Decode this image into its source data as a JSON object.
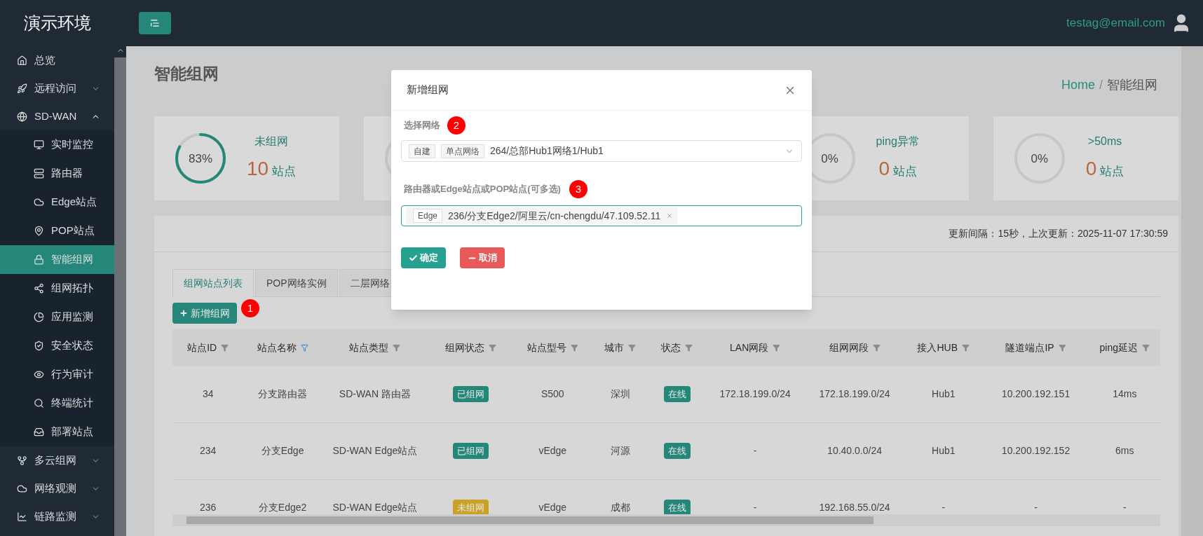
{
  "header": {
    "logo": "演示环境",
    "user": "testag@email.com"
  },
  "sidebar": {
    "items": [
      {
        "label": "总览",
        "expandable": false,
        "selected": false
      },
      {
        "label": "远程访问",
        "expandable": true,
        "expanded": false,
        "selected": false
      },
      {
        "label": "SD-WAN",
        "expandable": true,
        "expanded": true,
        "selected": false,
        "children": [
          {
            "label": "实时监控",
            "selected": false
          },
          {
            "label": "路由器",
            "selected": false
          },
          {
            "label": "Edge站点",
            "selected": false
          },
          {
            "label": "POP站点",
            "selected": false
          },
          {
            "label": "智能组网",
            "selected": true
          },
          {
            "label": "组网拓扑",
            "selected": false
          },
          {
            "label": "应用监测",
            "selected": false
          },
          {
            "label": "安全状态",
            "selected": false
          },
          {
            "label": "行为审计",
            "selected": false
          },
          {
            "label": "终端统计",
            "selected": false
          },
          {
            "label": "部署站点",
            "selected": false
          }
        ]
      },
      {
        "label": "多云组网",
        "expandable": true,
        "expanded": false,
        "selected": false
      },
      {
        "label": "网络观测",
        "expandable": true,
        "expanded": false,
        "selected": false
      },
      {
        "label": "链路监测",
        "expandable": true,
        "expanded": false,
        "selected": false
      }
    ]
  },
  "page": {
    "title": "智能组网",
    "breadcrumb": [
      "Home",
      "智能组网"
    ],
    "breadcrumb_separator": "/"
  },
  "stat_cards": [
    {
      "kind": "stat",
      "percent": "83%",
      "label": "未组网",
      "count": "10",
      "unit": "站点"
    },
    {
      "kind": "covered"
    },
    {
      "kind": "hidden"
    },
    {
      "kind": "stat",
      "percent": "0%",
      "label": "ping异常",
      "count": "0",
      "unit": "站点"
    },
    {
      "kind": "stat",
      "percent": "0%",
      "label": ">50ms",
      "count": "0",
      "unit": "站点"
    }
  ],
  "update_info": "更新间隔：15秒，上次更新：2025-11-07 17:30:59",
  "tabs": [
    {
      "label": "组网站点列表",
      "selected": true
    },
    {
      "label": "POP网络实例",
      "selected": false
    },
    {
      "label": "二层网络",
      "selected": false
    }
  ],
  "add_button": "新增组网",
  "markers": [
    "1",
    "2",
    "3"
  ],
  "table": {
    "columns": [
      {
        "label": "站点ID",
        "filtered": false
      },
      {
        "label": "站点名称",
        "filtered": true
      },
      {
        "label": "站点类型",
        "filtered": false
      },
      {
        "label": "组网状态",
        "filtered": false
      },
      {
        "label": "站点型号",
        "filtered": false
      },
      {
        "label": "城市",
        "filtered": false
      },
      {
        "label": "状态",
        "filtered": false
      },
      {
        "label": "LAN网段",
        "filtered": false
      },
      {
        "label": "组网网段",
        "filtered": false
      },
      {
        "label": "接入HUB",
        "filtered": false
      },
      {
        "label": "隧道端点IP",
        "filtered": false
      },
      {
        "label": "ping延迟",
        "filtered": false
      }
    ],
    "rows": [
      {
        "id": "34",
        "name": "分支路由器",
        "type": "SD-WAN 路由器",
        "net_status": {
          "text": "已组网",
          "color": "#24877a"
        },
        "model": "S500",
        "city": "深圳",
        "status": {
          "text": "在线",
          "color": "#24877a"
        },
        "lan": "172.18.199.0/24",
        "net_segment": "172.18.199.0/24",
        "hub": "Hub1",
        "tunnel_ip": "10.200.192.151",
        "ping": "14ms"
      },
      {
        "id": "234",
        "name": "分支Edge",
        "type": "SD-WAN Edge站点",
        "net_status": {
          "text": "已组网",
          "color": "#24877a"
        },
        "model": "vEdge",
        "city": "河源",
        "status": {
          "text": "在线",
          "color": "#24877a"
        },
        "lan": "-",
        "net_segment": "10.40.0.0/24",
        "hub": "Hub1",
        "tunnel_ip": "10.200.192.152",
        "ping": "6ms"
      },
      {
        "id": "236",
        "name": "分支Edge2",
        "type": "SD-WAN Edge站点",
        "net_status": {
          "text": "未组网",
          "color": "#c9a227"
        },
        "model": "vEdge",
        "city": "成都",
        "status": {
          "text": "在线",
          "color": "#24877a"
        },
        "lan": "-",
        "net_segment": "192.168.55.0/24",
        "hub": "-",
        "tunnel_ip": "-",
        "ping": "-"
      }
    ]
  },
  "dialog": {
    "title": "新增组网",
    "network_label": "选择网络",
    "network_tags": [
      "自建",
      "单点网络"
    ],
    "network_value": "264/总部Hub1网络1/Hub1",
    "sites_label": "路由器或Edge站点或POP站点(可多选)",
    "selected_sites": [
      {
        "tag": "Edge",
        "text": "236/分支Edge2/阿里云/cn-chengdu/47.109.52.11"
      }
    ],
    "confirm": "确定",
    "cancel": "取消"
  }
}
